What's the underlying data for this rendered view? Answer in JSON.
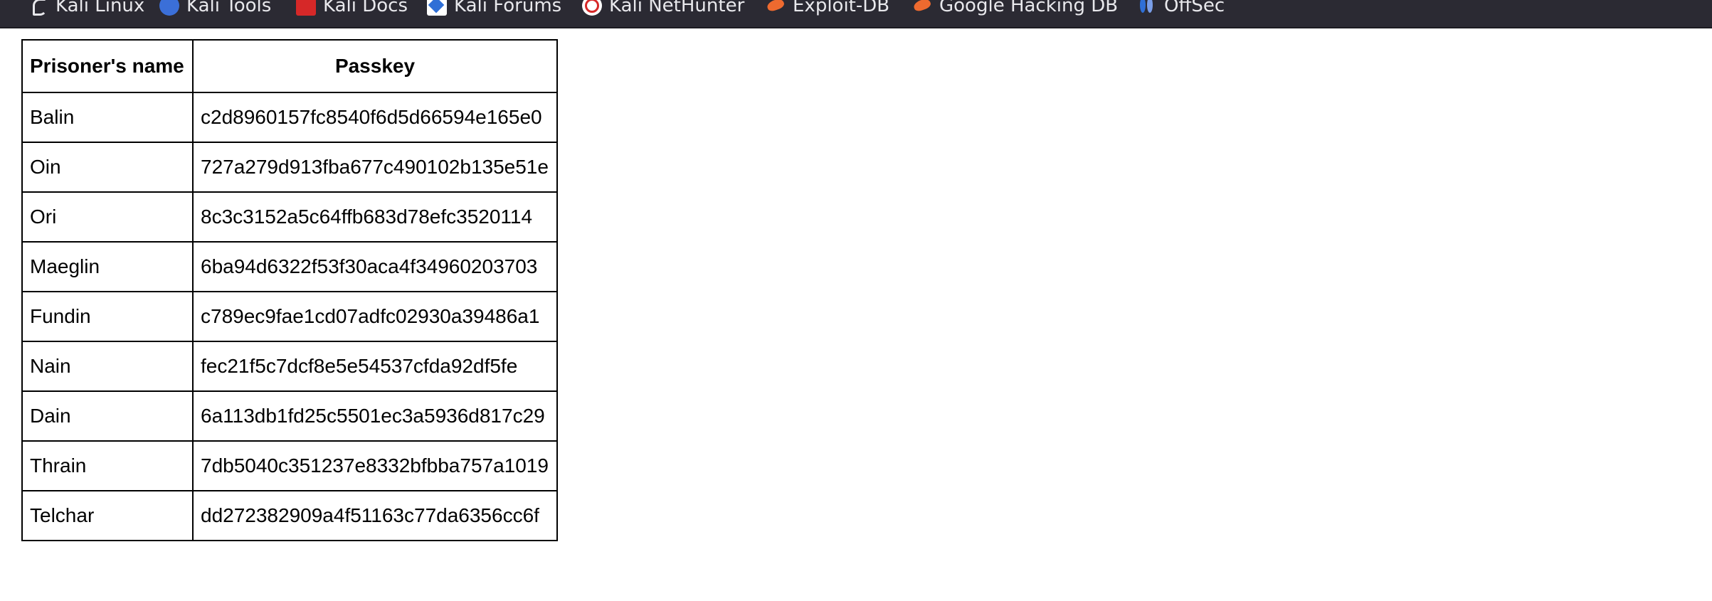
{
  "bookmarks": [
    {
      "label": "Kali Linux",
      "icon": "kali-dragon-icon"
    },
    {
      "label": "Kali Tools",
      "icon": "kali-tools-icon"
    },
    {
      "label": "Kali Docs",
      "icon": "kali-docs-icon"
    },
    {
      "label": "Kali Forums",
      "icon": "kali-forums-icon"
    },
    {
      "label": "Kali NetHunter",
      "icon": "nethunter-icon"
    },
    {
      "label": "Exploit-DB",
      "icon": "exploit-db-icon"
    },
    {
      "label": "Google Hacking DB",
      "icon": "ghdb-icon"
    },
    {
      "label": "OffSec",
      "icon": "offsec-icon"
    }
  ],
  "colors": {
    "toolbar_bg": "#2b2a33",
    "toolbar_text": "#e8e8ec",
    "page_bg": "#ffffff",
    "table_border": "#000000"
  },
  "table": {
    "headers": [
      "Prisoner's name",
      "Passkey"
    ],
    "rows": [
      {
        "name": "Balin",
        "passkey": "c2d8960157fc8540f6d5d66594e165e0"
      },
      {
        "name": "Oin",
        "passkey": "727a279d913fba677c490102b135e51e"
      },
      {
        "name": "Ori",
        "passkey": "8c3c3152a5c64ffb683d78efc3520114"
      },
      {
        "name": "Maeglin",
        "passkey": "6ba94d6322f53f30aca4f34960203703"
      },
      {
        "name": "Fundin",
        "passkey": "c789ec9fae1cd07adfc02930a39486a1"
      },
      {
        "name": "Nain",
        "passkey": "fec21f5c7dcf8e5e54537cfda92df5fe"
      },
      {
        "name": "Dain",
        "passkey": "6a113db1fd25c5501ec3a5936d817c29"
      },
      {
        "name": "Thrain",
        "passkey": "7db5040c351237e8332bfbba757a1019"
      },
      {
        "name": "Telchar",
        "passkey": "dd272382909a4f51163c77da6356cc6f"
      }
    ]
  }
}
